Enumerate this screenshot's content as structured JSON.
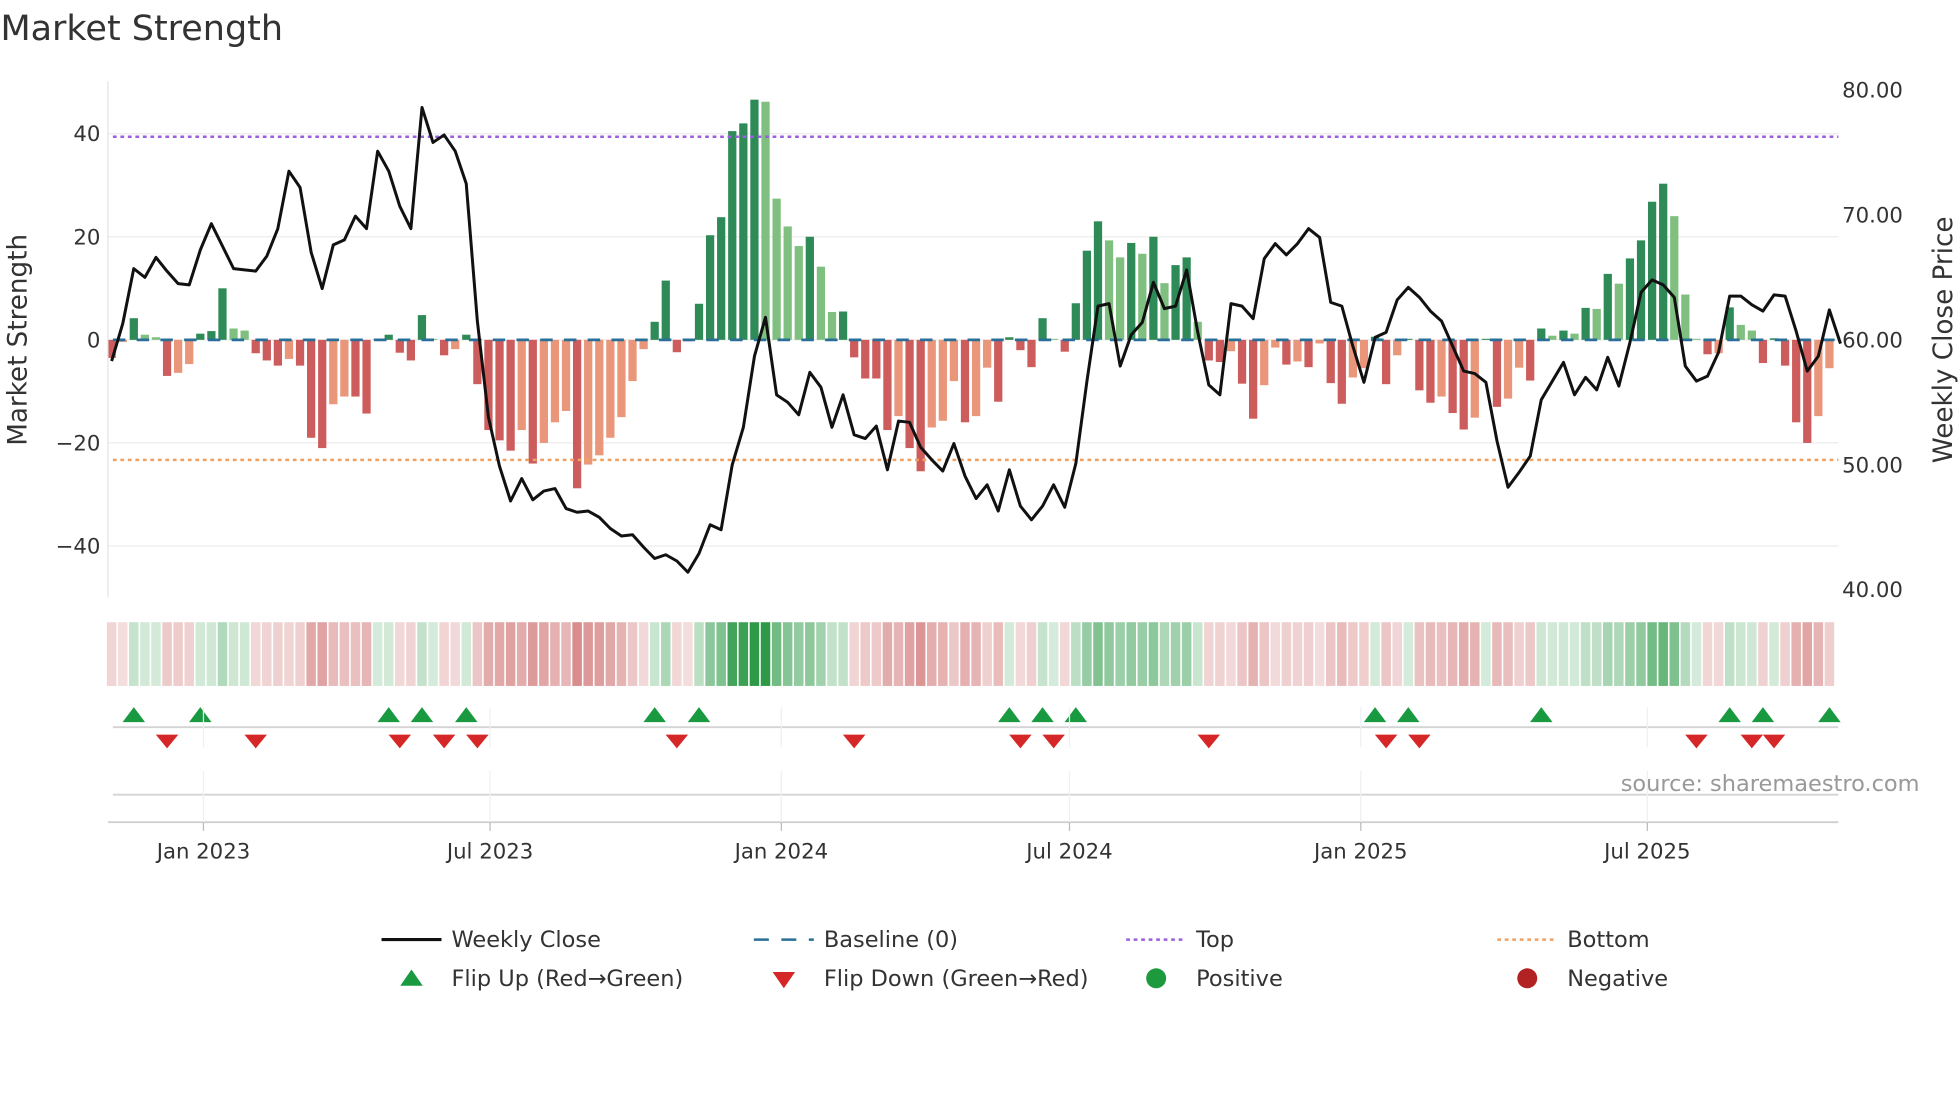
{
  "chart_data": {
    "type": "bar",
    "title": "Market Strength",
    "ylabel": "Market Strength",
    "y2label": "Weekly Close Price",
    "ylim": [
      -50,
      50
    ],
    "y2lim": [
      40,
      80.6
    ],
    "y_ticks": [
      {
        "value": 40,
        "label": "40"
      },
      {
        "value": 20,
        "label": "20"
      },
      {
        "value": 0,
        "label": "0"
      },
      {
        "value": -20,
        "label": "−20"
      },
      {
        "value": -40,
        "label": "−40"
      }
    ],
    "y2_ticks": [
      {
        "value": 80,
        "label": "80.00"
      },
      {
        "value": 70,
        "label": "70.00"
      },
      {
        "value": 60,
        "label": "60.00"
      },
      {
        "value": 50,
        "label": "50.00"
      },
      {
        "value": 40,
        "label": "40.00"
      }
    ],
    "x_ticks": [
      {
        "label": "Jan 2023",
        "date": "2023-01-01"
      },
      {
        "label": "Jul 2023",
        "date": "2023-07-01"
      },
      {
        "label": "Jan 2024",
        "date": "2024-01-01"
      },
      {
        "label": "Jul 2024",
        "date": "2024-07-01"
      },
      {
        "label": "Jan 2025",
        "date": "2025-01-01"
      },
      {
        "label": "Jul 2025",
        "date": "2025-07-01"
      }
    ],
    "start_date": "2022-11-04",
    "frequency": "weekly",
    "top_level": 39.4,
    "bottom_level": -23.3,
    "baseline": 0,
    "strength": [
      -3.5,
      -0.4,
      4.2,
      1,
      0.5,
      -7,
      -6.4,
      -4.7,
      1.2,
      1.7,
      10,
      2.2,
      1.8,
      -2.6,
      -4,
      -5,
      -3.7,
      -5,
      -19,
      -21,
      -12.5,
      -11,
      -11,
      -14.3,
      0.2,
      1,
      -2.5,
      -4,
      4.8,
      0.2,
      -3,
      -1.8,
      1,
      -8.6,
      -17.5,
      -19.5,
      -21.5,
      -17.5,
      -24,
      -20,
      -16,
      -13.8,
      -28.8,
      -24.2,
      -22.4,
      -19,
      -15,
      -8,
      -1.8,
      3.5,
      11.5,
      -2.4,
      -0.3,
      7,
      20.3,
      23.8,
      40.5,
      42,
      46.6,
      46.2,
      27.4,
      22,
      18.2,
      20,
      14.2,
      5.4,
      5.5,
      -3.4,
      -7.5,
      -7.5,
      -17.5,
      -14.8,
      -21,
      -25.5,
      -17,
      -15.7,
      -8,
      -16,
      -14.8,
      -5.4,
      -12,
      0.5,
      -2,
      -5.3,
      4.2,
      0.2,
      -2.3,
      7.1,
      17.3,
      23,
      19.3,
      16,
      18.8,
      16.7,
      20,
      11,
      14.5,
      16,
      3.5,
      -4,
      -4.3,
      -2.2,
      -8.5,
      -15.3,
      -8.8,
      -1.5,
      -4.8,
      -4.2,
      -5.3,
      -0.7,
      -8.4,
      -12.4,
      -7.3,
      -5.5,
      0.6,
      -8.6,
      -3,
      0.2,
      -9.8,
      -12.2,
      -11,
      -14.2,
      -17.4,
      -15.1,
      0.2,
      -13,
      -11.4,
      -5.4,
      -7.9,
      2.2,
      0.8,
      1.8,
      1.2,
      6.2,
      6,
      12.8,
      10.9,
      15.8,
      19.3,
      26.8,
      30.3,
      24,
      8.8,
      0.2,
      -2.8,
      -2.6,
      6.3,
      2.9,
      1.8,
      -4.5,
      0.3,
      -5,
      -16,
      -20,
      -14.8,
      -5.5
    ],
    "weekly_close": [
      58.3,
      61.3,
      65.7,
      65.0,
      66.6,
      65.5,
      64.5,
      64.4,
      67.2,
      69.3,
      67.5,
      65.7,
      65.6,
      65.5,
      66.7,
      68.9,
      73.5,
      72.2,
      67.0,
      64.1,
      67.6,
      68.0,
      69.9,
      68.9,
      75.1,
      73.5,
      70.7,
      68.9,
      78.6,
      75.8,
      76.4,
      75.1,
      72.5,
      61.5,
      53.8,
      49.9,
      47.1,
      48.9,
      47.2,
      47.9,
      48.1,
      46.5,
      46.2,
      46.3,
      45.8,
      44.9,
      44.3,
      44.4,
      43.4,
      42.5,
      42.8,
      42.3,
      41.4,
      42.9,
      45.2,
      44.8,
      50.0,
      53.0,
      58.7,
      61.8,
      55.6,
      55.0,
      54.0,
      57.4,
      56.2,
      53.0,
      55.6,
      52.4,
      52.1,
      53.1,
      49.6,
      53.5,
      53.4,
      51.4,
      50.4,
      49.5,
      51.7,
      49.1,
      47.3,
      48.4,
      46.3,
      49.6,
      46.7,
      45.6,
      46.7,
      48.4,
      46.6,
      50.1,
      56.7,
      62.7,
      62.9,
      57.9,
      60.4,
      61.4,
      64.6,
      62.5,
      62.7,
      65.6,
      60.6,
      56.4,
      55.6,
      62.9,
      62.7,
      61.7,
      66.5,
      67.7,
      66.8,
      67.7,
      68.9,
      68.2,
      63.0,
      62.7,
      59.5,
      56.6,
      60.2,
      60.6,
      63.2,
      64.2,
      63.4,
      62.3,
      61.5,
      59.5,
      57.5,
      57.3,
      56.6,
      51.9,
      48.2,
      49.4,
      50.7,
      55.2,
      56.7,
      58.2,
      55.6,
      57.0,
      56.0,
      58.6,
      56.3,
      59.8,
      63.8,
      64.8,
      64.4,
      63.4,
      57.9,
      56.7,
      57.1,
      59.0,
      63.5,
      63.5,
      62.8,
      62.3,
      63.6,
      63.5,
      60.7,
      57.5,
      58.7,
      62.4,
      59.7
    ],
    "flip_up_weeks": [
      2,
      8,
      25,
      28,
      32,
      49,
      53,
      81,
      84,
      87,
      114,
      117,
      129,
      146,
      149,
      155
    ],
    "flip_down_weeks": [
      5,
      13,
      26,
      30,
      33,
      51,
      67,
      82,
      85,
      99,
      115,
      118,
      143,
      148,
      150
    ],
    "legend": {
      "placement": "bottom",
      "items": [
        {
          "label": "Weekly Close",
          "marker": "solid-line",
          "color": "#111111"
        },
        {
          "label": "Baseline (0)",
          "marker": "dashed-line",
          "color": "#2a6f97"
        },
        {
          "label": "Top",
          "marker": "dotted-line",
          "color": "#9b5fe0"
        },
        {
          "label": "Bottom",
          "marker": "dotted-line",
          "color": "#f0a060"
        },
        {
          "label": "Flip Up (Red→Green)",
          "marker": "triangle-up",
          "color": "#1a9a40"
        },
        {
          "label": "Flip Down (Green→Red)",
          "marker": "triangle-down",
          "color": "#d62728"
        },
        {
          "label": "Positive",
          "marker": "circle",
          "color": "#1e9a3e"
        },
        {
          "label": "Negative",
          "marker": "circle",
          "color": "#b22222"
        }
      ]
    },
    "colors": {
      "pos_strong": "#2e8b57",
      "pos_weak": "#7fbf7f",
      "neg_strong": "#cd5c5c",
      "neg_weak": "#e9967a",
      "heat_pos": "#2e9a48",
      "heat_neg": "#c85a5a"
    },
    "source": "source: sharemaestro.com"
  }
}
